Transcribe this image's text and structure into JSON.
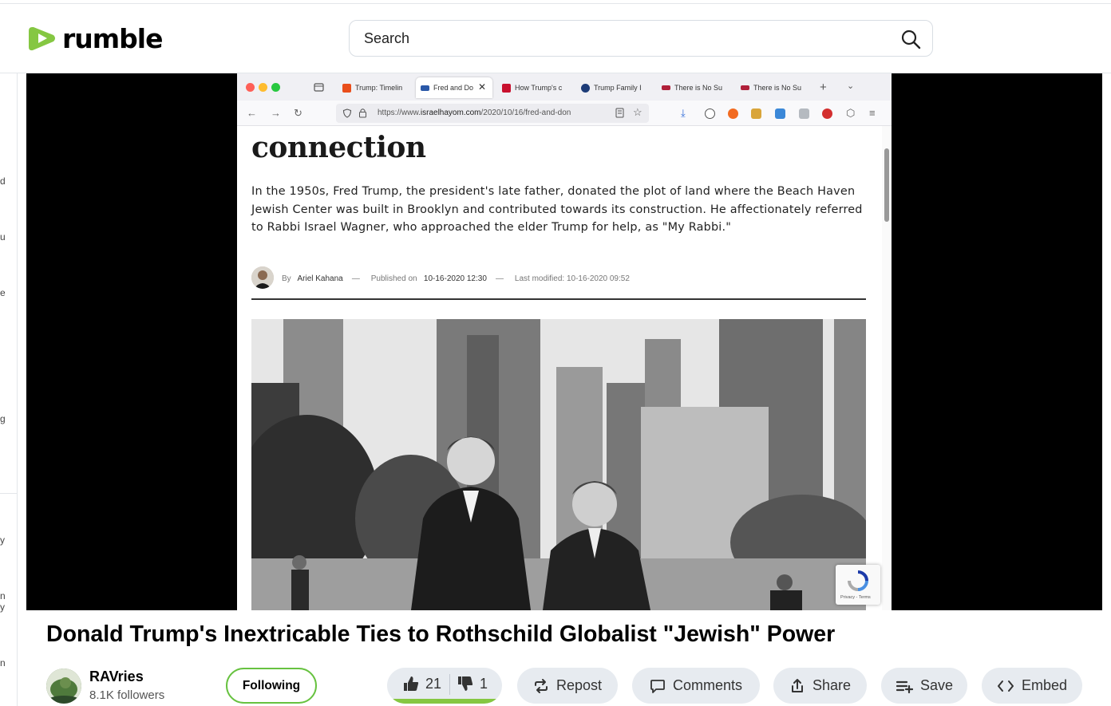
{
  "header": {
    "brand": "rumble",
    "search_placeholder": "Search"
  },
  "sidebar": {
    "fragments": [
      "d",
      "u",
      "e",
      "g",
      "y",
      "n",
      "y",
      "n"
    ]
  },
  "video": {
    "browser": {
      "tabs": [
        {
          "label": "Trump: Timelin",
          "active": false
        },
        {
          "label": "Fred and Do",
          "active": true
        },
        {
          "label": "How Trump's c",
          "active": false
        },
        {
          "label": "Trump Family I",
          "active": false
        },
        {
          "label": "There is No Su",
          "active": false
        },
        {
          "label": "There is No Su",
          "active": false
        }
      ],
      "url_prefix": "https://www.",
      "url_domain": "israelhayom.com",
      "url_path": "/2020/10/16/fred-and-don"
    },
    "article": {
      "headline": "connection",
      "body": "In the 1950s, Fred Trump, the president's late father, donated the plot of land where the Beach Haven Jewish Center was built in Brooklyn and contributed towards its construction. He affectionately referred to Rabbi Israel Wagner, who approached the elder Trump for help, as \"My Rabbi.\"",
      "by_label": "By",
      "author": "Ariel Kahana",
      "published_label": "Published on",
      "published": "10-16-2020 12:30",
      "modified": "Last modified: 10-16-2020 09:52"
    },
    "recaptcha": "Privacy - Terms"
  },
  "title": "Donald Trump's Inextricable Ties to Rothschild Globalist \"Jewish\" Power",
  "channel": {
    "name": "RAVries",
    "followers": "8.1K followers",
    "follow_label": "Following"
  },
  "actions": {
    "likes": "21",
    "dislikes": "1",
    "like_ratio": 0.955,
    "repost": "Repost",
    "comments": "Comments",
    "share": "Share",
    "save": "Save",
    "embed": "Embed"
  },
  "colors": {
    "brand_green": "#85c742",
    "follow_border": "#67c240",
    "pill_bg": "#e7ebf0"
  }
}
